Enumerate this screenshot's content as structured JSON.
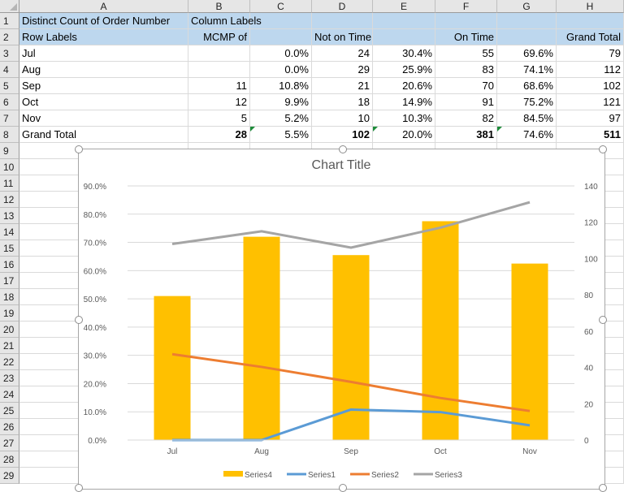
{
  "columns": [
    "A",
    "B",
    "C",
    "D",
    "E",
    "F",
    "G",
    "H"
  ],
  "rows": [
    "1",
    "2",
    "3",
    "4",
    "5",
    "6",
    "7",
    "8",
    "9",
    "10",
    "11",
    "12",
    "13",
    "14",
    "15",
    "16",
    "17",
    "18",
    "19",
    "20",
    "21",
    "22",
    "23",
    "24",
    "25",
    "26",
    "27",
    "28",
    "29"
  ],
  "pivot": {
    "row1": {
      "a": "Distinct Count of Order Number",
      "b": "Column Labels"
    },
    "row2": {
      "a": "Row Labels",
      "b": "MCMP of",
      "d": "Not on Time",
      "f": "On Time",
      "h": "Grand Total"
    },
    "body": [
      {
        "label": "Jul",
        "b": "",
        "c": "0.0%",
        "d": "24",
        "e": "30.4%",
        "f": "55",
        "g": "69.6%",
        "h": "79"
      },
      {
        "label": "Aug",
        "b": "",
        "c": "0.0%",
        "d": "29",
        "e": "25.9%",
        "f": "83",
        "g": "74.1%",
        "h": "112"
      },
      {
        "label": "Sep",
        "b": "11",
        "c": "10.8%",
        "d": "21",
        "e": "20.6%",
        "f": "70",
        "g": "68.6%",
        "h": "102"
      },
      {
        "label": "Oct",
        "b": "12",
        "c": "9.9%",
        "d": "18",
        "e": "14.9%",
        "f": "91",
        "g": "75.2%",
        "h": "121"
      },
      {
        "label": "Nov",
        "b": "5",
        "c": "5.2%",
        "d": "10",
        "e": "10.3%",
        "f": "82",
        "g": "84.5%",
        "h": "97"
      },
      {
        "label": "Grand Total",
        "b": "28",
        "c": "5.5%",
        "d": "102",
        "e": "20.0%",
        "f": "381",
        "g": "74.6%",
        "h": "511"
      }
    ]
  },
  "chart_data": {
    "type": "bar",
    "title": "Chart Title",
    "categories": [
      "Jul",
      "Aug",
      "Sep",
      "Oct",
      "Nov"
    ],
    "y_left": {
      "ticks": [
        "0.0%",
        "10.0%",
        "20.0%",
        "30.0%",
        "40.0%",
        "50.0%",
        "60.0%",
        "70.0%",
        "80.0%",
        "90.0%"
      ],
      "range": [
        0,
        90
      ]
    },
    "y_right": {
      "ticks": [
        "0",
        "20",
        "40",
        "60",
        "80",
        "100",
        "120",
        "140"
      ],
      "range": [
        0,
        140
      ]
    },
    "series": [
      {
        "name": "Series4",
        "kind": "bar",
        "axis": "left",
        "color": "#ffc000",
        "values": [
          51,
          72,
          65.5,
          77.5,
          62.5
        ]
      },
      {
        "name": "Series1",
        "kind": "line",
        "axis": "left",
        "color": "#5b9bd5",
        "values": [
          0,
          0,
          10.8,
          9.9,
          5.2
        ]
      },
      {
        "name": "Series2",
        "kind": "line",
        "axis": "left",
        "color": "#ed7d31",
        "values": [
          30.4,
          25.9,
          20.6,
          14.9,
          10.3
        ]
      },
      {
        "name": "Series3",
        "kind": "line",
        "axis": "right",
        "color": "#a5a5a5",
        "values": [
          108,
          115,
          106,
          117,
          131
        ]
      }
    ],
    "legend": "bottom",
    "grid": true
  }
}
